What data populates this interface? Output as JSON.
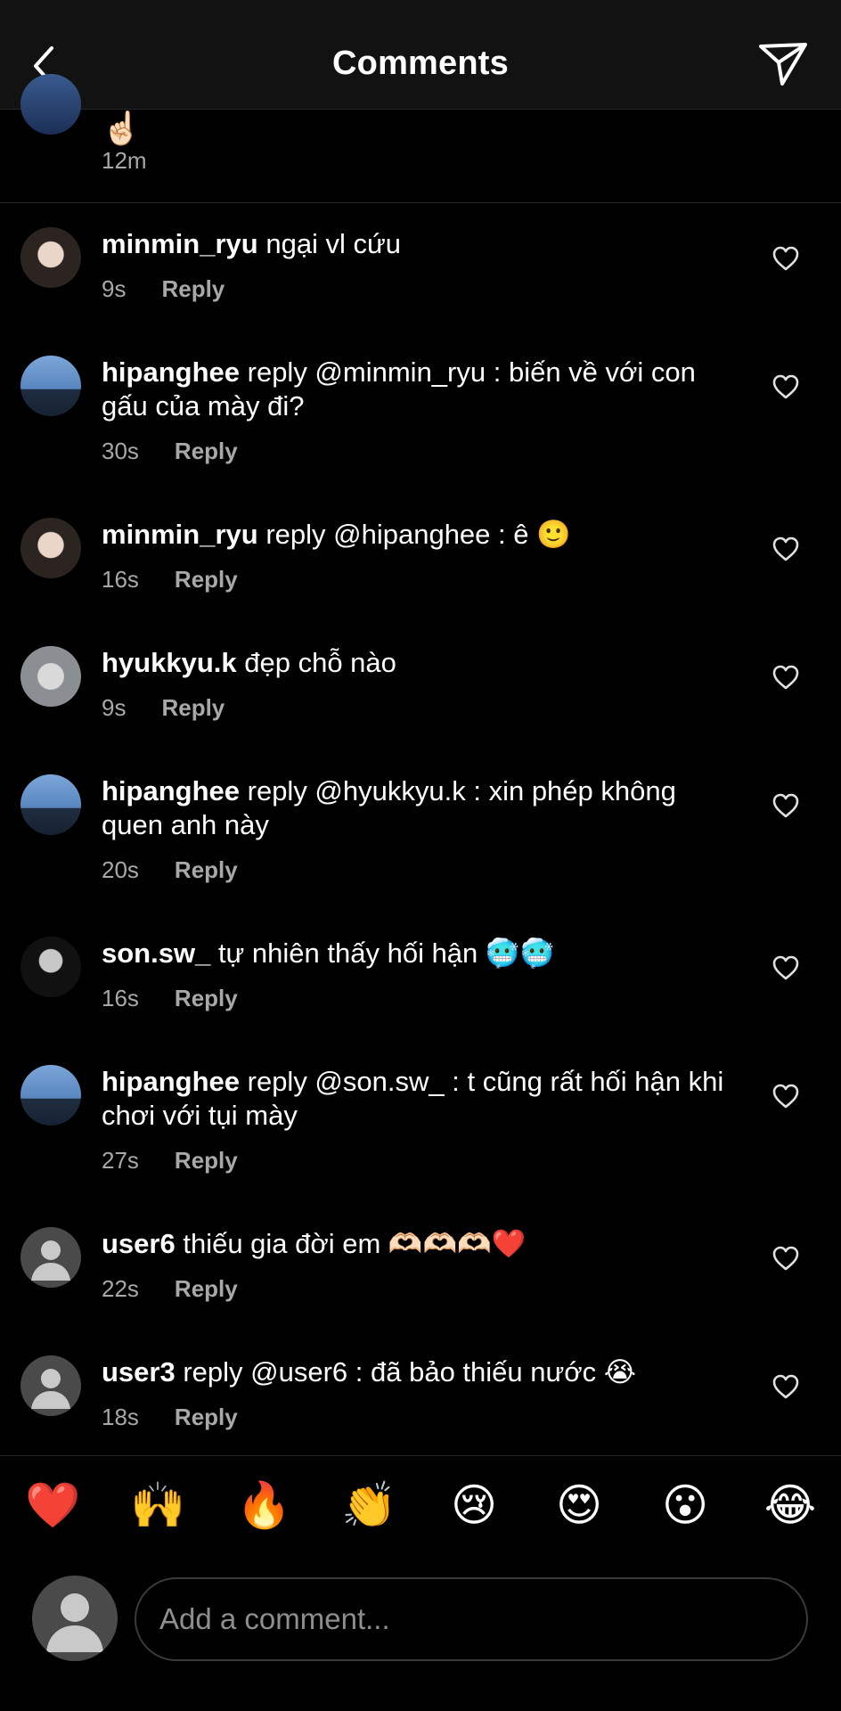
{
  "header": {
    "title": "Comments"
  },
  "partial_comment": {
    "emoji": "☝🏻",
    "time": "12m"
  },
  "comments": [
    {
      "user": "minmin_ryu",
      "text": " ngại vl cứu",
      "time": "9s",
      "reply": "Reply"
    },
    {
      "user": "hipanghee",
      "text": " reply @minmin_ryu : biến về với con gấu của mày đi?",
      "time": "30s",
      "reply": "Reply"
    },
    {
      "user": "minmin_ryu",
      "text": " reply @hipanghee : ê 🙂",
      "time": "16s",
      "reply": "Reply"
    },
    {
      "user": "hyukkyu.k",
      "text": " đẹp chỗ nào",
      "time": "9s",
      "reply": "Reply"
    },
    {
      "user": "hipanghee",
      "text": " reply @hyukkyu.k : xin phép không quen anh này",
      "time": "20s",
      "reply": "Reply"
    },
    {
      "user": "son.sw_",
      "text": " tự nhiên thấy hối hận 🥶🥶",
      "time": "16s",
      "reply": "Reply"
    },
    {
      "user": "hipanghee",
      "text": " reply @son.sw_ : t cũng rất hối hận khi chơi với tụi mày",
      "time": "27s",
      "reply": "Reply"
    },
    {
      "user": "user6",
      "text": " thiếu gia đời em 🫶🏻🫶🏻🫶🏻❤️",
      "time": "22s",
      "reply": "Reply"
    },
    {
      "user": "user3",
      "text": " reply @user6 : đã bảo thiếu nước 😭",
      "time": "18s",
      "reply": "Reply"
    }
  ],
  "emoji_bar": [
    "❤️",
    "🙌",
    "🔥",
    "👏",
    "😢",
    "😍",
    "😮",
    "😂"
  ],
  "composer": {
    "placeholder": "Add a comment..."
  },
  "colors": {
    "background": "#000000",
    "header": "#121212",
    "meta": "#a8a8a8",
    "divider": "#262626"
  },
  "icons": {
    "back": "chevron-left-icon",
    "send": "paper-plane-icon",
    "like": "heart-outline-icon",
    "avatar_default": "person-silhouette-icon"
  }
}
